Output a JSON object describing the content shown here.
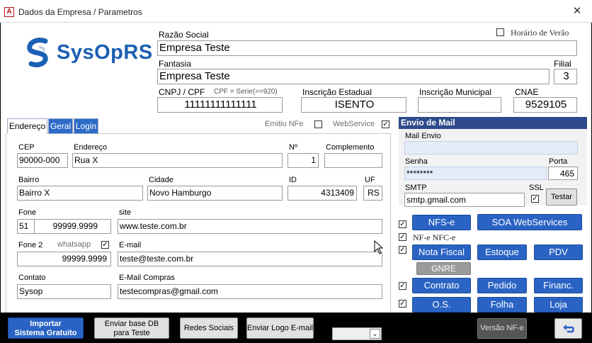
{
  "window": {
    "title": "Dados da Empresa / Parametros",
    "app_icon": "A"
  },
  "logo": {
    "text": "SysOpRS",
    "colors": {
      "swoosh": "#1a5fb4",
      "text": "#1a5fb4"
    }
  },
  "top": {
    "horario_verao_label": "Horário de Verão",
    "razao_social_label": "Razão Social",
    "razao_social_value": "Empresa Teste",
    "fantasia_label": "Fantasia",
    "fantasia_value": "Empresa Teste",
    "filial_label": "Filial",
    "filial_value": "3",
    "cnpj_label": "CNPJ / CPF",
    "cnpj_hint": "CPF = Serie(>=920)",
    "cnpj_value": "11111111111111",
    "ie_label": "Inscrição Estadual",
    "ie_value": "ISENTO",
    "im_label": "Inscrição Municipal",
    "im_value": "",
    "cnae_label": "CNAE",
    "cnae_value": "9529105"
  },
  "flags": {
    "emitiu_nfe_label": "Emitiu NFe",
    "webservice_label": "WebService"
  },
  "tabs": [
    {
      "label": "Endereço"
    },
    {
      "label": "Geral"
    },
    {
      "label": "Login"
    }
  ],
  "endereco": {
    "cep_label": "CEP",
    "cep_value": "90000-000",
    "endereco_label": "Endereço",
    "endereco_value": "Rua X",
    "numero_label": "Nº",
    "numero_value": "1",
    "complemento_label": "Complemento",
    "complemento_value": "",
    "bairro_label": "Bairro",
    "bairro_value": "Bairro X",
    "cidade_label": "Cidade",
    "cidade_value": "Novo Hamburgo",
    "id_label": "ID",
    "id_value": "4313409",
    "uf_label": "UF",
    "uf_value": "RS",
    "fone_label": "Fone",
    "fone_ddd": "51",
    "fone_value": "99999.9999",
    "site_label": "site",
    "site_value": "www.teste.com.br",
    "fone2_label": "Fone 2",
    "whatsapp_label": "whatsapp",
    "fone2_value": "99999.9999",
    "email_label": "E-mail",
    "email_value": "teste@teste.com.br",
    "contato_label": "Contato",
    "contato_value": "Sysop",
    "email_compras_label": "E-Mail Compras",
    "email_compras_value": "testecompras@gmail.com"
  },
  "mail": {
    "header": "Envio de Mail",
    "mail_envio_label": "Mail Envio",
    "mail_envio_value": "",
    "senha_label": "Senha",
    "senha_value": "********",
    "porta_label": "Porta",
    "porta_value": "465",
    "smtp_label": "SMTP",
    "smtp_value": "smtp.gmail.com",
    "ssl_label": "SSL",
    "testar_label": "Testar"
  },
  "modules": {
    "nfse": "NFS-e",
    "soa": "SOA WebServices",
    "nfe_nfce_label": "NF-e NFC-e",
    "nota_fiscal": "Nota Fiscal",
    "estoque": "Estoque",
    "pdv": "PDV",
    "gnre": "GNRE",
    "contrato": "Contrato",
    "pedido": "Pedido",
    "financ": "Financ.",
    "os": "O.S.",
    "folha": "Folha",
    "loja": "Loja"
  },
  "bottom": {
    "importar_line1": "Importar",
    "importar_line2": "Sistema Gratuito",
    "enviar_base_line1": "Enviar base DB",
    "enviar_base_line2": "para Teste",
    "redes_sociais": "Redes Sociais",
    "enviar_logo": "Enviar Logo E-mail",
    "versao_nfe": "Versão NF-e"
  },
  "colors": {
    "accent_blue": "#2a63c4",
    "mail_header": "#2e4a8c",
    "field_blue": "#e3ecf9"
  }
}
